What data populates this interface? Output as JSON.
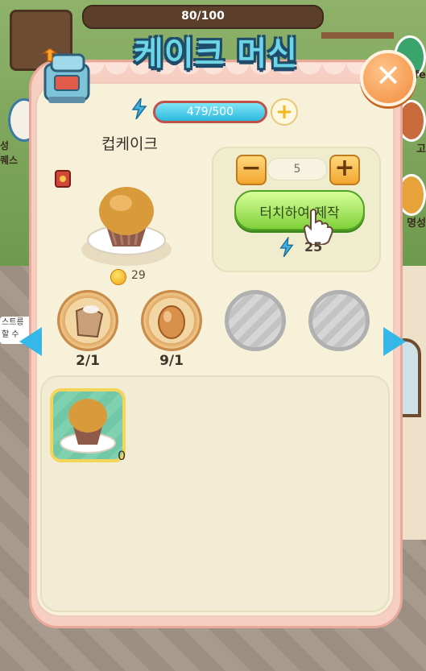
{
  "hud": {
    "level_progress": "80/100"
  },
  "background": {
    "left_labels": [
      "성",
      "퀘스"
    ],
    "right_labels": [
      "afe",
      "고",
      "명성"
    ],
    "store_sign": [
      "스트릉",
      "할 수"
    ]
  },
  "dialog": {
    "title": "케이크 머신",
    "close_icon": "close-icon",
    "machine_icon": "cake-machine-icon"
  },
  "energy": {
    "value": "479/500",
    "fill_fraction": 0.958,
    "add_label": "+"
  },
  "product": {
    "name": "컵케이크",
    "price": "29",
    "recipe_icon": "recipe-book-icon"
  },
  "craft": {
    "minus_label": "−",
    "plus_label": "+",
    "quantity": "5",
    "make_label": "터치하여 제작",
    "energy_cost": "25"
  },
  "ingredients": [
    {
      "name": "flour-sack-icon",
      "count": "2/1",
      "filled": true
    },
    {
      "name": "egg-icon",
      "count": "9/1",
      "filled": true
    },
    {
      "name": "empty-slot",
      "count": "",
      "filled": false
    },
    {
      "name": "empty-slot",
      "count": "",
      "filled": false
    }
  ],
  "inventory": {
    "items": [
      {
        "name": "cupcake-icon",
        "count": "0"
      }
    ]
  },
  "colors": {
    "title_fill": "#6cd5e6",
    "energy_bar": "#2db8e0",
    "make_button": "#7fd13a",
    "close_button": "#f28a3d"
  }
}
